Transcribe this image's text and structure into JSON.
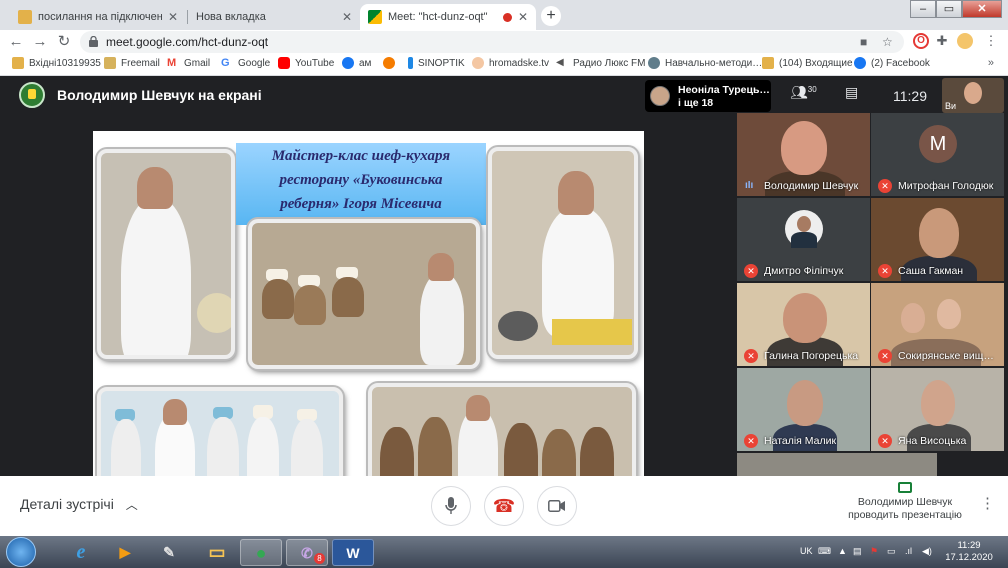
{
  "browser": {
    "tabs": [
      {
        "title": "посилання на підключення • пл",
        "active": false
      },
      {
        "title": "Нова вкладка",
        "active": false
      },
      {
        "title": "Meet: \"hct-dunz-oqt\"",
        "active": true,
        "recording": true
      }
    ],
    "new_tab": "+",
    "close_glyph": "✕",
    "url": "meet.google.com/hct-dunz-oqt",
    "bookmarks": [
      {
        "label": "Вхідні10319935",
        "icon": "mail-folder-icon",
        "color": "#e3b14a"
      },
      {
        "label": "Freemail",
        "icon": "freemail-icon",
        "color": "#d6b25c"
      },
      {
        "label": "Gmail",
        "icon": "gmail-icon",
        "color": "#ea4335"
      },
      {
        "label": "Google",
        "icon": "google-icon",
        "color": "#4285f4"
      },
      {
        "label": "YouTube",
        "icon": "youtube-icon",
        "color": "#ff0000"
      },
      {
        "label": "ам",
        "icon": "facebook-icon",
        "color": "#1877f2"
      },
      {
        "label": "",
        "icon": "orange-circle-icon",
        "color": "#f57c00"
      },
      {
        "label": "SINOPTIK",
        "icon": "sinoptik-icon",
        "color": "#1e88e5"
      },
      {
        "label": "hromadske.tv",
        "icon": "hromadske-icon",
        "color": "#f4c7a3"
      },
      {
        "label": "Радио Люкс FM",
        "icon": "radio-icon",
        "color": "#555555"
      },
      {
        "label": "Навчально-методи…",
        "icon": "globe-icon",
        "color": "#607d8b"
      },
      {
        "label": "(104) Входящие",
        "icon": "inbox-icon",
        "color": "#e3b14a"
      },
      {
        "label": "(2) Facebook",
        "icon": "facebook-icon",
        "color": "#1877f2"
      }
    ],
    "bookmarks_overflow": "»"
  },
  "meet": {
    "presenter_title": "Володимир Шевчук на екрані",
    "host_chip": {
      "line1": "Неоніла Турець…",
      "line2": "і ще 18"
    },
    "participants_count": "30",
    "time": "11:29",
    "self_label": "Ви",
    "slide": {
      "banner_lines": [
        "Майстер-клас шеф-кухаря",
        "ресторану «Буковинська",
        "реберня» Ігоря Місевича"
      ]
    },
    "participants": [
      {
        "name": "Володимир Шевчук",
        "speaking": true,
        "kind": "video"
      },
      {
        "name": "Митрофан Голодюк",
        "muted": true,
        "kind": "letter",
        "letter": "M"
      },
      {
        "name": "Дмитро Філіпчук",
        "muted": true,
        "kind": "photo"
      },
      {
        "name": "Саша Гакман",
        "muted": true,
        "kind": "video"
      },
      {
        "name": "Галина Погорецька",
        "muted": true,
        "kind": "video"
      },
      {
        "name": "Сокирянське вищ…",
        "muted": true,
        "kind": "video"
      },
      {
        "name": "Наталія Малик",
        "muted": true,
        "kind": "video"
      },
      {
        "name": "Яна Висоцька",
        "muted": true,
        "kind": "video"
      }
    ],
    "bottom": {
      "details": "Деталі зустрічі",
      "present_line1": "Володимир Шевчук",
      "present_line2": "проводить презентацію"
    }
  },
  "taskbar": {
    "apps": [
      {
        "name": "ie-icon",
        "glyph": "e",
        "color": "#3ea0e4",
        "open": false
      },
      {
        "name": "media-player-icon",
        "glyph": "▶",
        "color": "#f39c12",
        "open": false
      },
      {
        "name": "paint-icon",
        "glyph": "✎",
        "color": "#e0e0e0",
        "open": false
      },
      {
        "name": "folder-icon",
        "glyph": "▭",
        "color": "#f6c454",
        "open": false
      },
      {
        "name": "chrome-icon",
        "glyph": "●",
        "color": "#34a853",
        "open": true
      },
      {
        "name": "viber-icon",
        "glyph": "✆",
        "color": "#7b519d",
        "open": true,
        "badge": "8"
      },
      {
        "name": "word-icon",
        "glyph": "W",
        "color": "#2b579a",
        "open": true
      }
    ],
    "lang": "UK",
    "clock_time": "11:29",
    "clock_date": "17.12.2020"
  }
}
